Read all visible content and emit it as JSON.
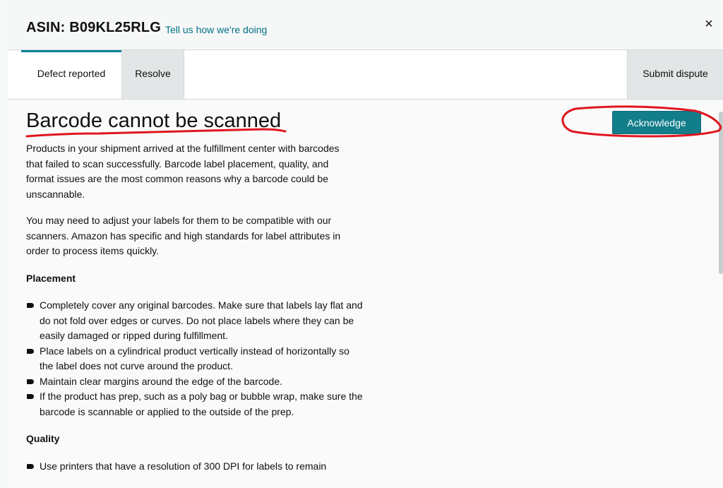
{
  "header": {
    "asin_title": "ASIN: B09KL25RLG",
    "feedback_link": "Tell us how we're doing",
    "close_label": "×"
  },
  "tabs": {
    "defect": "Defect reported",
    "resolve": "Resolve",
    "dispute": "Submit dispute"
  },
  "main": {
    "heading": "Barcode cannot be scanned",
    "acknowledge_label": "Acknowledge",
    "intro_paragraph_1": "Products in your shipment arrived at the fulfillment center with barcodes that failed to scan successfully. Barcode label placement, quality, and format issues are the most common reasons why a barcode could be unscannable.",
    "intro_paragraph_2": "You may need to adjust your labels for them to be compatible with our scanners. Amazon has specific and high standards for label attributes in order to process items quickly.",
    "placement": {
      "title": "Placement",
      "items": [
        "Completely cover any original barcodes. Make sure that labels lay flat and do not fold over edges or curves. Do not place labels where they can be easily damaged or ripped during fulfillment.",
        "Place labels on a cylindrical product vertically instead of horizontally so the label does not curve around the product.",
        "Maintain clear margins around the edge of the barcode.",
        "If the product has prep, such as a poly bag or bubble wrap, make sure the barcode is scannable or applied to the outside of the prep."
      ]
    },
    "quality": {
      "title": "Quality",
      "items": [
        "Use printers that have a resolution of 300 DPI for labels to remain"
      ]
    }
  },
  "annotation_color": "#e0161e",
  "accent_color": "#127e8a"
}
